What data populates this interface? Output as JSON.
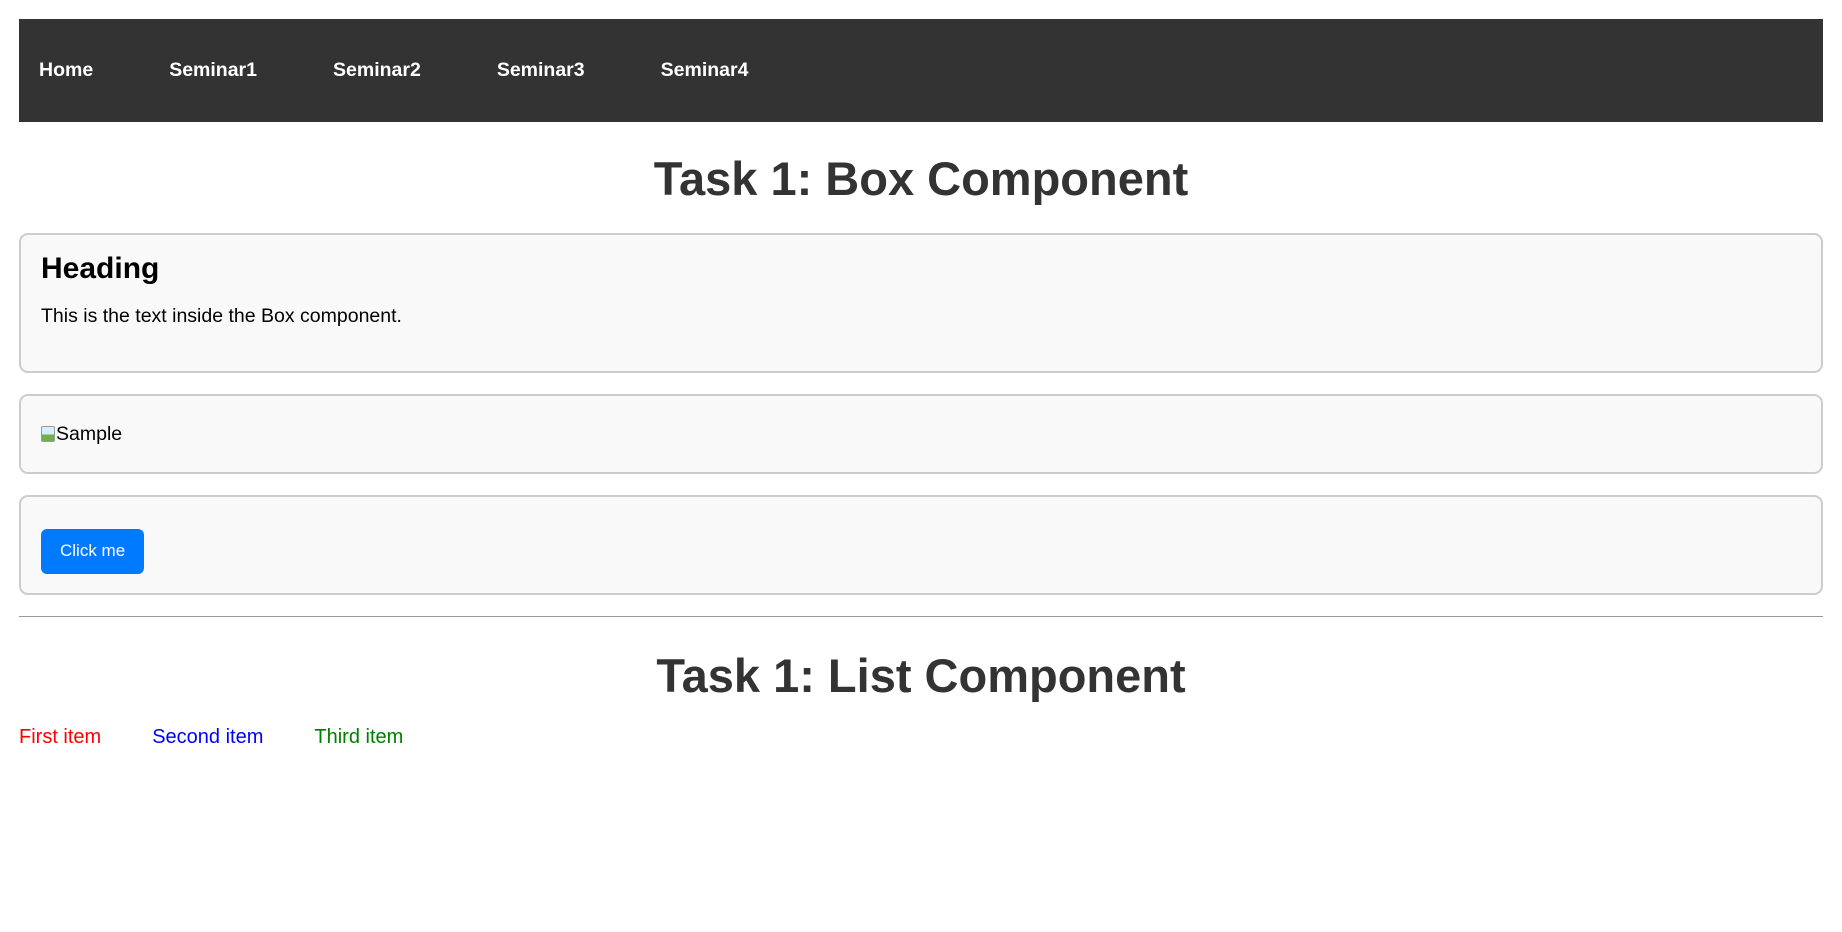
{
  "navbar": {
    "links": [
      {
        "label": "Home"
      },
      {
        "label": "Seminar1"
      },
      {
        "label": "Seminar2"
      },
      {
        "label": "Seminar3"
      },
      {
        "label": "Seminar4"
      }
    ]
  },
  "task_box": {
    "title": "Task 1: Box Component",
    "box1": {
      "heading": "Heading",
      "text": "This is the text inside the Box component."
    },
    "box2": {
      "image_alt": "Sample"
    },
    "box3": {
      "button_label": "Click me",
      "button_color": "#007bff"
    }
  },
  "task_list": {
    "title": "Task 1: List Component",
    "items": [
      {
        "label": "First item",
        "color": "#ff0000"
      },
      {
        "label": "Second item",
        "color": "#0000ff"
      },
      {
        "label": "Third item",
        "color": "#008000"
      }
    ]
  },
  "colors": {
    "navbar_bg": "#333333",
    "title_text": "#333333",
    "box_bg": "#f9f9f9",
    "box_border": "#cccccc"
  }
}
